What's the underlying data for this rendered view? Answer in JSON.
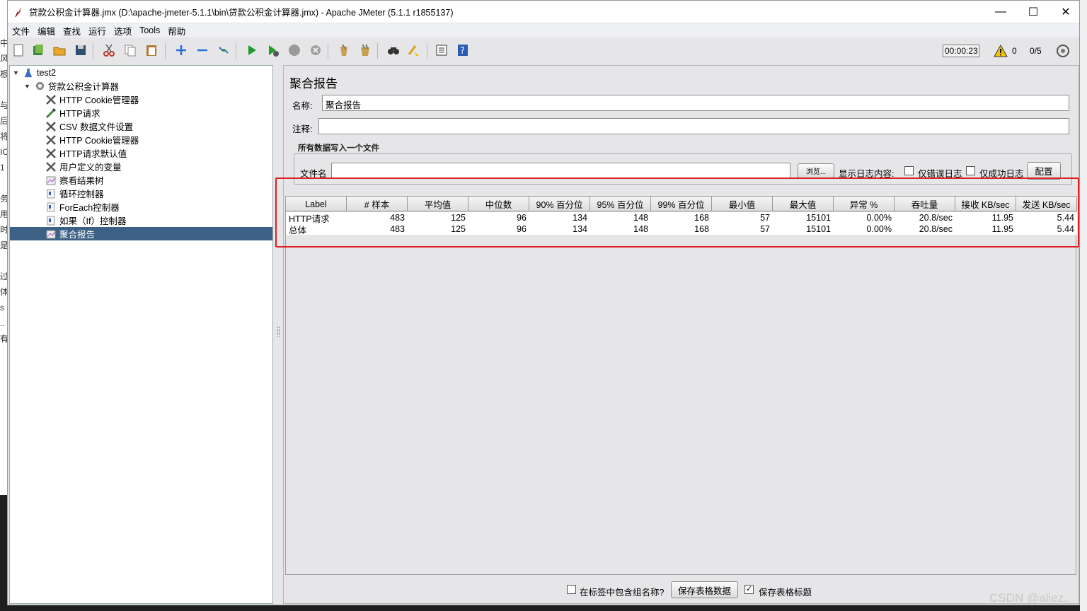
{
  "window": {
    "title": "贷款公积金计算器.jmx (D:\\apache-jmeter-5.1.1\\bin\\贷款公积金计算器.jmx) - Apache JMeter (5.1.1 r1855137)"
  },
  "menu": [
    "文件",
    "编辑",
    "查找",
    "运行",
    "选项",
    "Tools",
    "帮助"
  ],
  "toolbar": {
    "timer": "00:00:23",
    "warnings": "0",
    "threads": "0/5"
  },
  "tree": {
    "root": "test2",
    "plan": "贷款公积金计算器",
    "items": [
      "HTTP Cookie管理器",
      "HTTP请求",
      "CSV 数据文件设置",
      "HTTP Cookie管理器",
      "HTTP请求默认值",
      "用户定义的变量",
      "察看结果树",
      "循环控制器",
      "ForEach控制器",
      "如果（If）控制器",
      "聚合报告"
    ]
  },
  "panel": {
    "title": "聚合报告",
    "name_label": "名称:",
    "name_value": "聚合报告",
    "comment_label": "注释:",
    "comment_value": "",
    "group_title": "所有数据写入一个文件",
    "filename_label": "文件名",
    "filename_value": "",
    "browse_label": "浏览...",
    "log_label": "显示日志内容:",
    "errors_only": "仅错误日志",
    "success_only": "仅成功日志",
    "config_label": "配置"
  },
  "table": {
    "columns": [
      "Label",
      "# 样本",
      "平均值",
      "中位数",
      "90% 百分位",
      "95% 百分位",
      "99% 百分位",
      "最小值",
      "最大值",
      "异常 %",
      "吞吐量",
      "接收 KB/sec",
      "发送 KB/sec"
    ],
    "rows": [
      [
        "HTTP请求",
        "483",
        "125",
        "96",
        "134",
        "148",
        "168",
        "57",
        "15101",
        "0.00%",
        "20.8/sec",
        "11.95",
        "5.44"
      ],
      [
        "总体",
        "483",
        "125",
        "96",
        "134",
        "148",
        "168",
        "57",
        "15101",
        "0.00%",
        "20.8/sec",
        "11.95",
        "5.44"
      ]
    ]
  },
  "bottom": {
    "include_group_label": "在标签中包含组名称?",
    "save_table_label": "保存表格数据",
    "save_header_label": "保存表格标题"
  },
  "watermark": "CSDN @aliez..",
  "left_strip_text": [
    "中",
    "风",
    "根",
    "",
    "与",
    "后",
    "将",
    "IC",
    "1",
    "",
    "务",
    "用",
    "时",
    "是",
    "",
    "过",
    "体",
    "s",
    "..",
    "有"
  ]
}
